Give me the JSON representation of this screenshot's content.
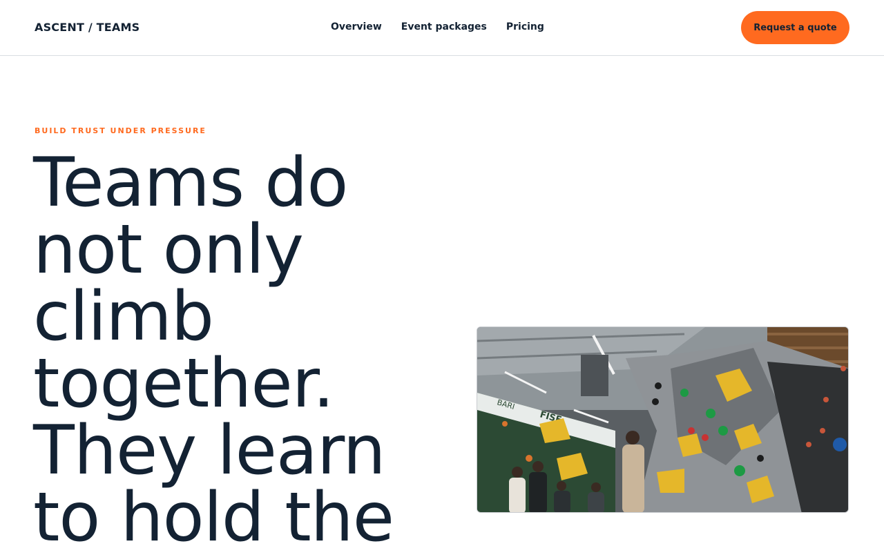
{
  "header": {
    "brand": "ASCENT / TEAMS",
    "nav": [
      {
        "label": "Overview"
      },
      {
        "label": "Event packages"
      },
      {
        "label": "Pricing"
      }
    ],
    "cta_label": "Request a quote"
  },
  "hero": {
    "eyebrow": "BUILD TRUST UNDER PRESSURE",
    "headline": "Teams do not only climb together. They learn to hold the",
    "photo_wall_text": [
      "BARI",
      "FISE"
    ]
  },
  "colors": {
    "accent": "#ff6a1f",
    "text": "#132233"
  }
}
